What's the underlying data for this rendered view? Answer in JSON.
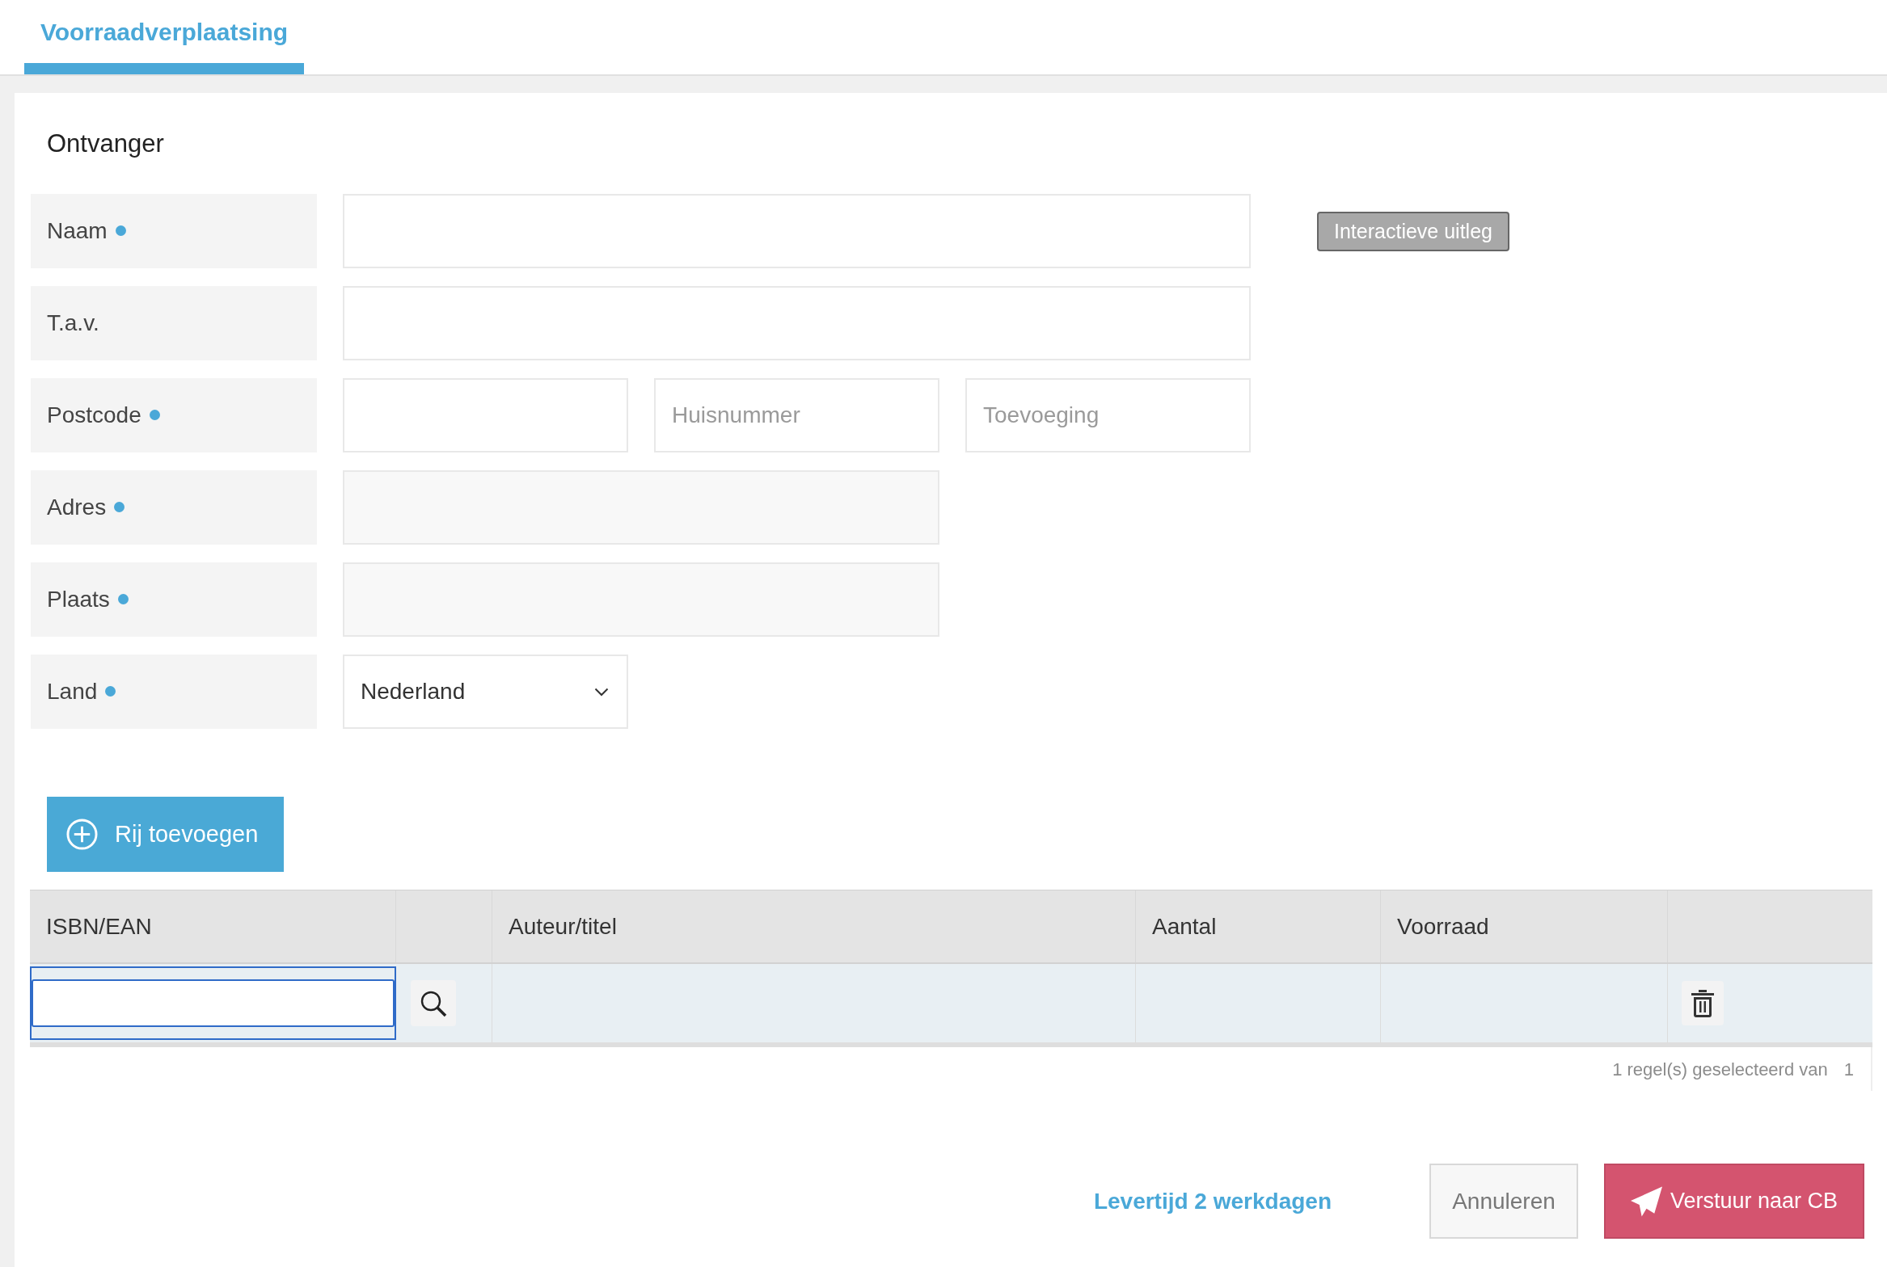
{
  "tabs": [
    {
      "label": "Voorraadverplaatsing",
      "selected": true
    }
  ],
  "recipient": {
    "title": "Ontvanger",
    "rows": [
      {
        "label": "Naam",
        "required": true,
        "fields": [
          {
            "kind": "text"
          }
        ]
      },
      {
        "label": "T.a.v.",
        "required": false,
        "fields": [
          {
            "kind": "text"
          }
        ]
      },
      {
        "label": "Postcode",
        "required": true,
        "fields": [
          {
            "kind": "text"
          },
          {
            "kind": "text",
            "placeholder": "Huisnummer"
          },
          {
            "kind": "text",
            "placeholder": "Toevoeging"
          }
        ]
      },
      {
        "label": "Adres",
        "required": true,
        "fields": [
          {
            "kind": "readonly"
          }
        ]
      },
      {
        "label": "Plaats",
        "required": true,
        "fields": [
          {
            "kind": "readonly"
          }
        ]
      },
      {
        "label": "Land",
        "required": true,
        "fields": [
          {
            "kind": "select",
            "value": "Nederland"
          }
        ]
      }
    ]
  },
  "help_button": {
    "label": "Interactieve uitleg"
  },
  "add_row_button": {
    "label": "Rij toevoegen"
  },
  "table": {
    "columns": [
      {
        "kind": "isbn",
        "label": "ISBN/EAN"
      },
      {
        "kind": "search"
      },
      {
        "kind": "text",
        "label": "Auteur/titel"
      },
      {
        "kind": "text",
        "label": "Aantal"
      },
      {
        "kind": "text",
        "label": "Voorraad"
      },
      {
        "kind": "delete"
      }
    ],
    "rows": [
      {
        "selected": true,
        "editing": true
      }
    ],
    "selection_summary": {
      "text": "1 regel(s) geselecteerd van",
      "count": "1"
    }
  },
  "footer": {
    "delivery_note": "Levertijd 2 werkdagen",
    "buttons": [
      {
        "kind": "secondary",
        "label": "Annuleren"
      },
      {
        "kind": "primary",
        "label": "Verstuur naar CB"
      }
    ]
  }
}
